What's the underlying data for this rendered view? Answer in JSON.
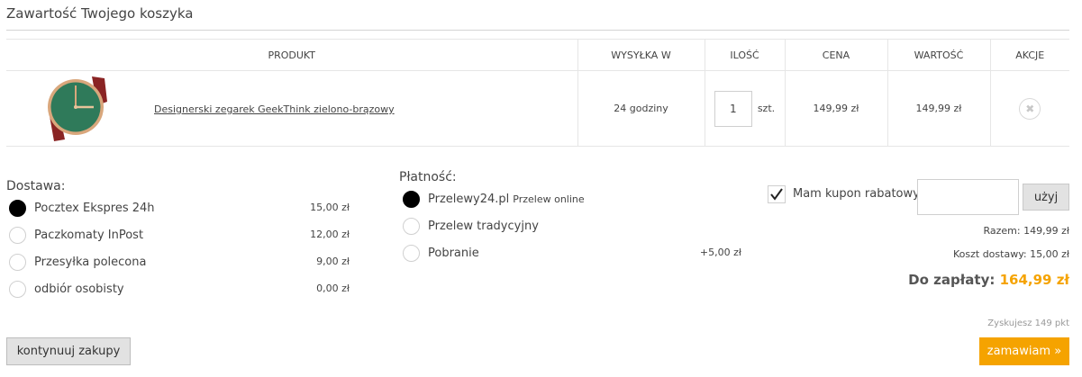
{
  "page": {
    "title": "Zawartość Twojego koszyka"
  },
  "table": {
    "headers": [
      "PRODUKT",
      "WYSYŁKA W",
      "ILOŚĆ",
      "CENA",
      "WARTOŚĆ",
      "AKCJE"
    ],
    "rows": [
      {
        "name": "Designerski zegarek GeekThink zielono-brązowy",
        "shipping": "24 godziny",
        "qty": "1",
        "unit": "szt.",
        "price": "149,99 zł",
        "value": "149,99 zł",
        "remove_icon": "close-icon"
      }
    ]
  },
  "delivery": {
    "label": "Dostawa:",
    "options": [
      {
        "label": "Pocztex Ekspres 24h",
        "price": "15,00 zł",
        "selected": true
      },
      {
        "label": "Paczkomaty InPost",
        "price": "12,00 zł",
        "selected": false
      },
      {
        "label": "Przesyłka polecona",
        "price": "9,00 zł",
        "selected": false
      },
      {
        "label": "odbiór osobisty",
        "price": "0,00 zł",
        "selected": false
      }
    ]
  },
  "payment": {
    "label": "Płatność:",
    "options": [
      {
        "label": "Przelewy24.pl",
        "note": "Przelew online",
        "price": "",
        "selected": true
      },
      {
        "label": "Przelew tradycyjny",
        "note": "",
        "price": "",
        "selected": false
      },
      {
        "label": "Pobranie",
        "note": "",
        "price": "+5,00 zł",
        "selected": false
      }
    ]
  },
  "coupon": {
    "label": "Mam kupon rabatowy",
    "checked": true,
    "value": "",
    "button": "użyj"
  },
  "summary": {
    "subtotal": "Razem: 149,99 zł",
    "shipping": "Koszt dostawy: 15,00 zł",
    "total_label": "Do zapłaty:",
    "total_value": "164,99 zł",
    "points": "Zyskujesz 149 pkt"
  },
  "buttons": {
    "continue": "kontynuuj zakupy",
    "order": "zamawiam »"
  },
  "colors": {
    "accent": "#f5a300",
    "button_gray": "#e2e2e2",
    "text": "#444444",
    "border": "#e6e6e6"
  }
}
